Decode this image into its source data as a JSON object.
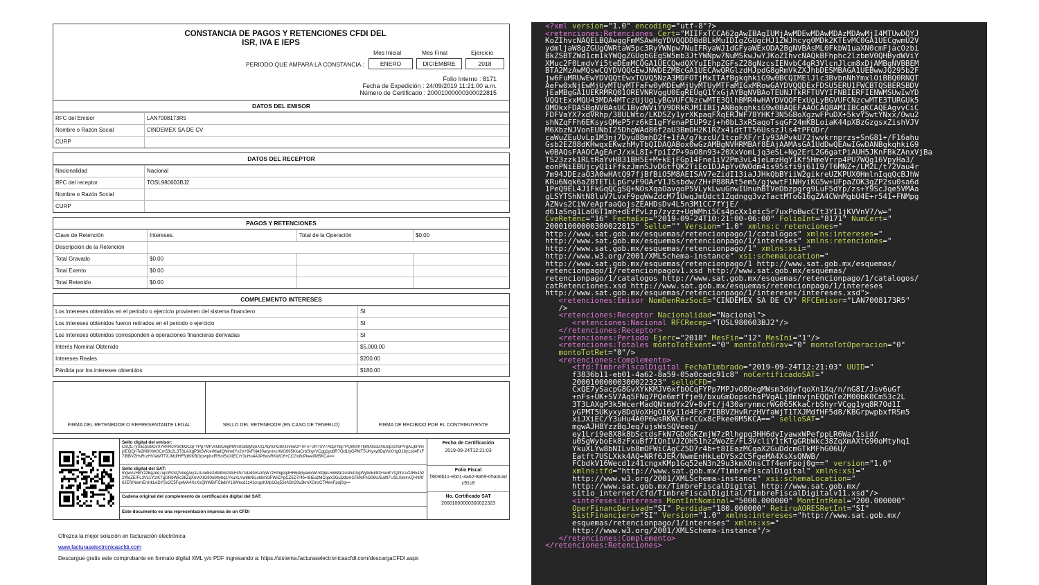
{
  "header": {
    "title_line1": "CONSTANCIA DE PAGOS Y RETENCIONES CFDI DEL",
    "title_line2": "ISR, IVA E IEPS",
    "mes_inicial_label": "Mes Inicial",
    "mes_final_label": "Mes Final",
    "ejercicio_label": "Ejercicio",
    "periodo_label": "PERIODO QUE AMPARA LA CONSTANCIA :",
    "mes_inicial": "ENERO",
    "mes_final": "DICIEMBRE",
    "ejercicio": "2018",
    "folio_interno": "Folio Interno : 8171",
    "fecha_expedicion": "Fecha de Expedición : 24/09/2019 11:21:00 a.m.",
    "numero_certificado": "Número de Certificado : 20001000000300022815"
  },
  "emisor": {
    "heading": "DATOS DEL EMISOR",
    "rows": [
      [
        "RFC del Emisor",
        "LAN7008173R5"
      ],
      [
        "Nombre o Razón Social",
        "CINDEMEX SA DE CV"
      ],
      [
        "CURP",
        ""
      ]
    ]
  },
  "receptor": {
    "heading": "DATOS DEL RECEPTOR",
    "rows": [
      [
        "Nacionalidad",
        "Nacional"
      ],
      [
        "RFC del receptor",
        "TOSL980603BJ2"
      ],
      [
        "Nombre o Razón Social",
        ""
      ],
      [
        "CURP",
        ""
      ]
    ]
  },
  "pagos": {
    "heading": "PAGOS Y RETENCIONES",
    "clave_label": "Clave de Retención",
    "clave_value": "Intereses.",
    "total_op_label": "Total de la Operación",
    "total_op_value": "$0.00",
    "rows": [
      [
        "Descripción de la Retención",
        ""
      ],
      [
        "Total Gravado",
        "$0.00"
      ],
      [
        "Total Exento",
        "$0.00"
      ],
      [
        "Total Retenido",
        "$0.00"
      ]
    ]
  },
  "complemento": {
    "heading": "COMPLEMENTO INTERESES",
    "rows": [
      [
        "Los intereses obtenidos en el periodo o ejercicio provienen del sistema financiero",
        "SI"
      ],
      [
        "Los intereses obtenidos fueron retirados en el periodo o ejercicio",
        "SI"
      ],
      [
        "Los intereses obtenidos corresponden a operaciones financieras derivadas",
        "SI"
      ],
      [
        "Interés Nominal Obtenido",
        "$5,000.00"
      ],
      [
        "Intereses Reales",
        "$200.00"
      ],
      [
        "Pérdida por los intereses obtenidos",
        "$180.00"
      ]
    ]
  },
  "firmas": [
    "FIRMA DEL RETENEDOR O REPRESENTANTE LEGAL",
    "SELLO DEL RETENEDOR (EN CASO DE TENERLO)",
    "FIRMA DE RECIBIDO POR EL CONTRIBUYENTE"
  ],
  "timbre": {
    "sello_emisor_label": "Sello digital del emisor:",
    "sello_emisor": "CxQE7ySacpG8GvXYkKMJV6xfbOCqFYPp7MPJvO8OegMWsm3ddyfqoXn1Xq/n/nG8I/Jsv6uGf+nFs+UK+SV7Aq5FNg7PQe6mfTfje9/bxuGmDopschsPVgALj8mhvjnEQQnTe2M00bK0Cm53c2L3T3LAXgP3k5WcerMadQNtmdYx2V+8vFt/j430arynmcrWG065KkaCrbShyrVCgg1yq8R7Od1IyGPMT5UKyxy8DqVoXHgO16y11d4FxF7IBBVZHvRrzHVfaWTTXJMdfHF5d8/KBGrpwpbxfRSm5xiXiEC/Y3uHu4A0P6wsRKWC6+CCGx8cPkee0M5KCA==",
    "sello_sat_label": "Sello digital del SAT:",
    "sello_sat": "mgwAJH8YzzBgJeq7ujsWsSQVeeg/ey1LrLrie8eX8k8bSctdsFkN7GDdGKZmjW7zRlhgpq3HH6dyIyawxWPefppLR6Wa/1sid/u0SgWyboEk8zFxuBf7IQnIVJZOH51hz2WoZE/FL3Vc1Y1tKTgGRbWkc38ZqXmAXtG90oMtyhq1YkuXLYw8bNILvb8mOFWiCAgCZ5D7r4b+t8IEazMCqaX2GuDdcmGTkMFhG06U/Eatft7USLXkk4AQ+NRf6JER/NwmEnHkLeDYSx2C5FgeMA4XsXsQNWB/FCbdkV16Wecd1z41cngxKMp1Gq52eN3n29u3kmXOnsCTf4enFpoj0g==",
    "cadena_label": "Cadena original del complemento de certificación digital del SAT:",
    "representacion": "Este documento es una representación impresa de un CFDI",
    "fecha_cert_label": "Fecha de Certificación",
    "fecha_cert": "2019-09-24T12:21:03",
    "folio_fiscal_label": "Folio Fiscal",
    "folio_fiscal": "f3836b11-eb01-4a62-8a59-05a0cadc91c8",
    "no_cert_label": "No. Certificado SAT",
    "no_cert": "20001000000300022323"
  },
  "footer": {
    "line1": "Ofrezca la mejor solución en facturación electrónica",
    "link": "www.facturaselectronicascfdi.com",
    "line3": "Descargue gratis este comprobante en formato digital XML y/o PDF ingresando a:  https://sistema.facturaselectronicascfdi.com/descargaCFDI.aspx"
  },
  "xml_lines": [
    [
      [
        "t",
        "<?xml "
      ],
      [
        "a",
        "version"
      ],
      [
        "v",
        "=\"1.0\" "
      ],
      [
        "a",
        "encoding"
      ],
      [
        "v",
        "=\"utf-8\"?>"
      ]
    ],
    [
      [
        "t",
        "<retenciones:Retenciones "
      ],
      [
        "a",
        "Cert"
      ],
      [
        "v",
        "=\"MIIFxTCCA62gAwIBAgIUMjAwMDEwMDAwMDAzMDAwMjI4MTUwDQYJ"
      ]
    ],
    [
      [
        "v",
        "KoZIhvcNAQELBQAwggFmMSAwHgYDVQQDDBdBLkMuIDIgZGUgcHJ1ZWJhcyg0MDk2KTEvMC0GA1UECgwmU2V"
      ]
    ],
    [
      [
        "v",
        "ydmljaW8gZGUgQWRtaW5pc3RyYWNpw7NuIFRyaWJ1dGFyaWExODA2BgNVBAsML0FkbW1uaXN0cmFjacOzbi"
      ]
    ],
    [
      [
        "v",
        "BkZSBTZWd1cm1kYWQgZGUgbGEgSW5mb3JtYWNpw7NuMSkwJwYJKoZIhvcNAQkBFhphc2lzbmV0QHBydWViY"
      ]
    ],
    [
      [
        "v",
        "XMuc2F0LmdvYi5teDEmMCQGA1UECQwdQXYuIEhpZGFsZ28gNzcsIENvbC4gR3VlcnJlcm8xDjAMBgNVBBEM"
      ]
    ],
    [
      [
        "v",
        "BTA2MzAwMQswCQYDVQQGEwJNWDEZMBcGA1UECAwQRGlzdHJpdG8gRmVkZXJhbDESMBAGA1UEBwwJQ295b2F"
      ]
    ],
    [
      [
        "v",
        "jw6FuMRUwEwYDVQQtEwxTQVQ5NzA3MDFOTjMxITAfBgkqhkiG9w0BCQIMElJlc3BvbnNhYmxlOiBBQ0RNQT"
      ]
    ],
    [
      [
        "v",
        "AeFw0xNjEwMjUyMTUyMTFaFw0yMDEwMjUyMTUyMTFaMIGxMRowGAYDVQQDExFDSU5ERU1FWCBTQSBERSBDV"
      ]
    ],
    [
      [
        "v",
        "jEaMBgGA1UEKRMRQ01OREVNRVggU0EgREUgQ1YxGjAYBgNVBAoTEUNJTkRFTUVYIFNBIERFIENWMSUwIwYD"
      ]
    ],
    [
      [
        "v",
        "VQQtExxMQU43MDA4MTczUjUgLyBGVUFCNzcwMTE3QlhBMR4wHAYDVQQFExUgLyBGVUFCNzcwMTE3TURGUk5"
      ]
    ],
    [
      [
        "v",
        "OMDkxFDASBgNVBAsUC1BydWViYV9DRkRJMIIBIjANBgkqhkiG9w0BAQEFAAOCAQ8AMIIBCgKCAQEAgvvCiC"
      ]
    ],
    [
      [
        "v",
        "FDFVaYX7xdVRhp/38ULWto/LKDSZy1yrXKpaqFXqERJWF78YHKf3N5GBoXgzwFPuDX+5kvY5wtYNxx/Owu2"
      ]
    ],
    [
      [
        "v",
        "shNZqFFh6EKsysQMeP5rz6kE1gFYenaPEUP9zj+h0bL3xR5aqoTsqGF24mKBLoiaK44pXBzGzgsxZishVJV"
      ]
    ],
    [
      [
        "v",
        "M6XbzNJVonEUNbI25DhgWAd86f2aU3BmOH2K1RZx41dtTT56UsszJls4tPFODr/"
      ]
    ],
    [
      [
        "v",
        "caWuZEuUvLp1M3nj7Dyu88mhD2f+1fA/g7kzcU/1tcpFXF/rIy93APvkU72jwvkrnprzs+SnG81+/F16ahu"
      ]
    ],
    [
      [
        "v",
        "Gsb2EZ88dKHwqxEKwzhMyTbQIDAQABox0wGzAMBgNVHRMBAf8EAjAAMAsGA1UdDwQEAwIGwDANBgkqhkiG9"
      ]
    ],
    [
      [
        "v",
        "w0BAQsFAAOCAgEArJ/xkL8I+fpiIZP+9aO8n93+20XxVomLjq3eSL+Ng2ErL2G6gatPiAUH5JKnFBkZAnxVjBa"
      ]
    ],
    [
      [
        "v",
        "TS23zzk1RLtRaYvH831BH5E+M+kEjFGp14Fne1iV2Pm3vL4jeLmzHgY1Kf5HmeVrrp4PU7WQg16VpyHa3/"
      ]
    ],
    [
      [
        "v",
        "eonPNiEBUjcyQ1iFfkzJmnSJvDGtfQK2TiEo1DJApYv0WOdm4is95sfi9j61I9/T6MNZ+/LM2L/t72Vau4r"
      ]
    ],
    [
      [
        "v",
        "7m94JDEzaO3A0wHAtQ97fjBfBiO5M8AEISAV7eZidI13iaJJHkQbBYiiW2gikreUZKPUX0HmlnIqqQcBJhW"
      ]
    ],
    [
      [
        "v",
        "KRu6Nqk6aZBTETLLpGrvF9OArV1JSsbdw/ZH+P88RAt5em5/gjwwtF1NHyiKG5w+UFpaZOK3gZP2su0sa6d"
      ]
    ],
    [
      [
        "v",
        "1PeQ9EL4J1FkGqQCgSQ+NOsXqaOavgoP5VLykLwuGnwIUnuhBTVeDbzpgrg9LuF5dYp/zs+Y9ScJqe5VMAa"
      ]
    ],
    [
      [
        "v",
        "gLSYTShNtN8luV7LvxF9pgWwZdcM71UwqJmUdct1Zqdngg3vzTactMToG16gZA4CWnMgbU4E+r541+FNMpg"
      ]
    ],
    [
      [
        "v",
        "AZNvs2CiW/eApfaaQojsZEAHDsDv4L5n3M1CC7fYjE/"
      ]
    ],
    [
      [
        "v",
        "d61aSng1LaO6T1mh+dEfPvLzp7zyzz+UgWMhi5Cs4pcXx1eic5r7uxPoBwcCTt3YI1jKVVnV7/w=\""
      ]
    ],
    [
      [
        "a",
        "CveRetenc"
      ],
      [
        "v",
        "=\"16\" "
      ],
      [
        "a",
        "FechaExp"
      ],
      [
        "v",
        "=\"2019-09-24T10:21:00-06:00\" "
      ],
      [
        "a",
        "FolioInt"
      ],
      [
        "v",
        "=\"8171\" "
      ],
      [
        "a",
        "NumCert"
      ],
      [
        "v",
        "=\""
      ]
    ],
    [
      [
        "v",
        "20001000000300022815\" "
      ],
      [
        "a",
        "Sello"
      ],
      [
        "v",
        "=\"\" "
      ],
      [
        "a",
        "Version"
      ],
      [
        "v",
        "=\"1.0\" "
      ],
      [
        "a",
        "xmlns:c_retenciones"
      ],
      [
        "v",
        "=\""
      ]
    ],
    [
      [
        "v",
        "http://www.sat.gob.mx/esquemas/retencionpago/1/catalogos\" "
      ],
      [
        "a",
        "xmlns:intereses"
      ],
      [
        "v",
        "=\""
      ]
    ],
    [
      [
        "v",
        "http://www.sat.gob.mx/esquemas/retencionpago/1/intereses\" "
      ],
      [
        "a",
        "xmlns:retenciones"
      ],
      [
        "v",
        "=\""
      ]
    ],
    [
      [
        "v",
        "http://www.sat.gob.mx/esquemas/retencionpago/1\" "
      ],
      [
        "a",
        "xmlns:xsi"
      ],
      [
        "v",
        "=\""
      ]
    ],
    [
      [
        "v",
        "http://www.w3.org/2001/XMLSchema-instance\" "
      ],
      [
        "a",
        "xsi:schemaLocation"
      ],
      [
        "v",
        "=\""
      ]
    ],
    [
      [
        "v",
        "http://www.sat.gob.mx/esquemas/retencionpago/1 http://www.sat.gob.mx/esquemas/"
      ]
    ],
    [
      [
        "v",
        "retencionpago/1/retencionpagov1.xsd http://www.sat.gob.mx/esquemas/"
      ]
    ],
    [
      [
        "v",
        "retencionpago/1/catalogos http://www.sat.gob.mx/esquemas/retencionpago/1/catalogos/"
      ]
    ],
    [
      [
        "v",
        "catRetenciones.xsd http://www.sat.gob.mx/esquemas/retencionpago/1/intereses"
      ]
    ],
    [
      [
        "v",
        "http://www.sat.gob.mx/esquemas/retencionpago/1/intereses/intereses.xsd\">"
      ]
    ],
    [
      [
        "v",
        "   "
      ],
      [
        "t",
        "<retenciones:Emisor "
      ],
      [
        "a",
        "NomDenRazSocE"
      ],
      [
        "v",
        "=\"CINDEMEX SA DE CV\" "
      ],
      [
        "a",
        "RFCEmisor"
      ],
      [
        "v",
        "=\"LAN7008173R5\""
      ]
    ],
    [
      [
        "v",
        "   />"
      ]
    ],
    [
      [
        "v",
        "   "
      ],
      [
        "t",
        "<retenciones:Receptor "
      ],
      [
        "a",
        "Nacionalidad"
      ],
      [
        "v",
        "=\"Nacional\">"
      ]
    ],
    [
      [
        "v",
        "      "
      ],
      [
        "t",
        "<retenciones:Nacional "
      ],
      [
        "a",
        "RFCRecep"
      ],
      [
        "v",
        "=\"TOSL980603BJ2\"/>"
      ]
    ],
    [
      [
        "v",
        "   "
      ],
      [
        "t",
        "</retenciones:Receptor>"
      ]
    ],
    [
      [
        "v",
        "   "
      ],
      [
        "t",
        "<retenciones:Periodo "
      ],
      [
        "a",
        "Ejerc"
      ],
      [
        "v",
        "=\"2018\" "
      ],
      [
        "a",
        "MesFin"
      ],
      [
        "v",
        "=\"12\" "
      ],
      [
        "a",
        "MesIni"
      ],
      [
        "v",
        "=\"1\"/>"
      ]
    ],
    [
      [
        "v",
        "   "
      ],
      [
        "t",
        "<retenciones:Totales "
      ],
      [
        "a",
        "montoTotExent"
      ],
      [
        "v",
        "=\"0\" "
      ],
      [
        "a",
        "montoTotGrav"
      ],
      [
        "v",
        "=\"0\" "
      ],
      [
        "a",
        "montoTotOperacion"
      ],
      [
        "v",
        "=\"0\""
      ]
    ],
    [
      [
        "v",
        "   "
      ],
      [
        "a",
        "montoTotRet"
      ],
      [
        "v",
        "=\"0\"/>"
      ]
    ],
    [
      [
        "v",
        "   "
      ],
      [
        "t",
        "<retenciones:Complemento>"
      ]
    ],
    [
      [
        "v",
        "      "
      ],
      [
        "t",
        "<tfd:TimbreFiscalDigital "
      ],
      [
        "a",
        "FechaTimbrado"
      ],
      [
        "v",
        "=\"2019-09-24T12:21:03\" "
      ],
      [
        "a",
        "UUID"
      ],
      [
        "v",
        "=\""
      ]
    ],
    [
      [
        "v",
        "      f3836b11-eb01-4a62-8a59-05a0cadc91c8\" "
      ],
      [
        "a",
        "noCertificadoSAT"
      ],
      [
        "v",
        "=\""
      ]
    ],
    [
      [
        "v",
        "      20001000000300022323\" "
      ],
      [
        "a",
        "selloCFD"
      ],
      [
        "v",
        "=\""
      ]
    ],
    [
      [
        "v",
        "      CxQE7ySacpG8GvXYkKMJV6xfbOCqFYPp7MPJvO8OegMWsm3ddyfqoXn1Xq/n/nG8I/Jsv6uGf"
      ]
    ],
    [
      [
        "v",
        "      +nFs+UK+SV7Aq5FNg7PQe6mfTfje9/bxuGmDopschsPVgALj8mhvjnEQQnTe2M00bK0Cm53c2L"
      ]
    ],
    [
      [
        "v",
        "      3T3LAXgP3k5WcerMadQNtmdYx2V+8vFt/j430arynmcrWG065KkaCrbShyrVCgg1yq8R7Od1I"
      ]
    ],
    [
      [
        "v",
        "      yGPMT5UKyxy8DqVoXHgO16y11d4FxF7IBBVZHvRrzHVfaWjT1TXJMdfHF5d8/KBGrpwpbxfRSm5"
      ]
    ],
    [
      [
        "v",
        "      xiJXiEC/Y3uHu4A0P6wsRKWC6+CCGx8cPkee0M5KCA==\" "
      ],
      [
        "a",
        "selloSAT"
      ],
      [
        "v",
        "=\""
      ]
    ],
    [
      [
        "v",
        "      mgwAJH8YzzBgJeq7ujsWsSQVeeg/"
      ]
    ],
    [
      [
        "v",
        "      ey1Lri9e8X8k8bSctdsFkN7GDdGKZmjW7zRlhgpq3HH6dyIyawxWPefppLR6Wa/1sid/"
      ]
    ],
    [
      [
        "v",
        "      u0SgWyboEk8zFxuBf7IQnIVJZOH51hz2WoZE/FL3VcliY1tKTgGRbWkc38ZqXmAXtG90oMtyhq1"
      ]
    ],
    [
      [
        "v",
        "      YkuXLYw8bNILvb8mOFWiCAgCZ5D7r4b+t8IEazMCqaX2GuDdcmGTkMFhG06U/"
      ]
    ],
    [
      [
        "v",
        "      Eatft7USLXkk4AQ+NRf6JER/NwmEnHkLeDYSx2C5FgeMA4XsXsQNWB/"
      ]
    ],
    [
      [
        "v",
        "      FCbdkV16Wecd1z41cngxKMp1Gq52eN3n29u3kmXOnsCTf4enFpoj0g==\" "
      ],
      [
        "a",
        "version"
      ],
      [
        "v",
        "=\"1.0\""
      ]
    ],
    [
      [
        "v",
        "      "
      ],
      [
        "a",
        "xmlns:tfd"
      ],
      [
        "v",
        "=\"http://www.sat.gob.mx/TimbreFiscalDigital\" "
      ],
      [
        "a",
        "xmlns:xsi"
      ],
      [
        "v",
        "=\""
      ]
    ],
    [
      [
        "v",
        "      http://www.w3.org/2001/XMLSchema-instance\" "
      ],
      [
        "a",
        "xsi:schemaLocation"
      ],
      [
        "v",
        "=\""
      ]
    ],
    [
      [
        "v",
        "      http://www.sat.gob.mx/TimbreFiscalDigital http://www.sat.gob.mx/"
      ]
    ],
    [
      [
        "v",
        "      sitio_internet/cfd/TimbreFiscalDigital/TimbreFiscalDigitalv11.xsd\"/>"
      ]
    ],
    [
      [
        "v",
        "      "
      ],
      [
        "t",
        "<intereses:Intereses "
      ],
      [
        "a",
        "MontIntNominal"
      ],
      [
        "v",
        "=\"5000.000000\" "
      ],
      [
        "a",
        "MontIntReal"
      ],
      [
        "v",
        "=\"200.000000\""
      ]
    ],
    [
      [
        "v",
        "      "
      ],
      [
        "a",
        "OperFinancDerivad"
      ],
      [
        "v",
        "=\"SI\" "
      ],
      [
        "a",
        "Perdida"
      ],
      [
        "v",
        "=\"180.000000\" "
      ],
      [
        "a",
        "RetiroAORESRetInt"
      ],
      [
        "v",
        "=\"SI\""
      ]
    ],
    [
      [
        "v",
        "      "
      ],
      [
        "a",
        "SistFinanciero"
      ],
      [
        "v",
        "=\"SI\" "
      ],
      [
        "a",
        "Version"
      ],
      [
        "v",
        "=\"1.0\" "
      ],
      [
        "a",
        "xmlns:intereses"
      ],
      [
        "v",
        "=\"http://www.sat.gob.mx/"
      ]
    ],
    [
      [
        "v",
        "      esquemas/retencionpago/1/intereses\" "
      ],
      [
        "a",
        "xmlns:xs"
      ],
      [
        "v",
        "=\""
      ]
    ],
    [
      [
        "v",
        "      http://www.w3.org/2001/XMLSchema-instance\"/>"
      ]
    ],
    [
      [
        "v",
        "   "
      ],
      [
        "t",
        "</retenciones:Complemento>"
      ]
    ],
    [
      [
        "t",
        "</retenciones:Retenciones>"
      ]
    ]
  ]
}
